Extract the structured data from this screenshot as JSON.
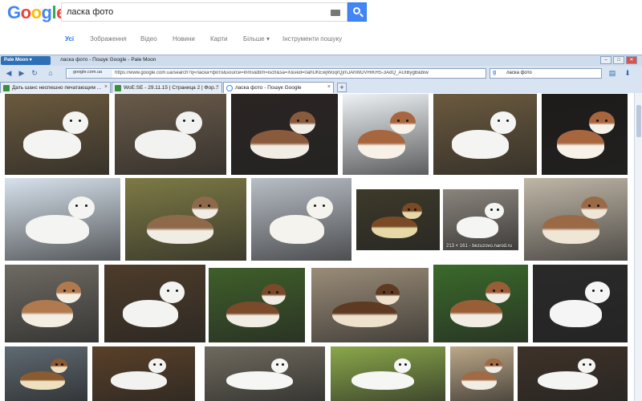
{
  "search": {
    "logo_letters": [
      {
        "ch": "G",
        "color": "#4285f4"
      },
      {
        "ch": "o",
        "color": "#ea4335"
      },
      {
        "ch": "o",
        "color": "#fbbc05"
      },
      {
        "ch": "g",
        "color": "#4285f4"
      },
      {
        "ch": "l",
        "color": "#34a853"
      },
      {
        "ch": "e",
        "color": "#ea4335"
      }
    ],
    "query": "ласка фото"
  },
  "tabs": [
    {
      "label": "Усі",
      "active": true
    },
    {
      "label": "Зображення",
      "active": false
    },
    {
      "label": "Відео",
      "active": false
    },
    {
      "label": "Новини",
      "active": false
    },
    {
      "label": "Карти",
      "active": false
    },
    {
      "label": "Більше ▾",
      "active": false
    },
    {
      "label": "Інструменти пошуку",
      "active": false
    }
  ],
  "browser": {
    "menu_button": "Pale Moon ▾",
    "window_title": "ласка фото - Пошук Google - Pale Moon",
    "url_domain": "google.com.ua",
    "url": "https://www.google.com.ua/search?q=ласка+фото&source=lnms&tbm=isch&sa=X&ved=0ahUKEwjWoqrQjrnJAhWDVHIKHS-3AdQ_AUIBygB&biw",
    "search_value": "ласка фото",
    "tabs": [
      {
        "label": "Дать шанс неспешно печатающим ...",
        "active": false
      },
      {
        "label": "WoE:SE - 29.11.15 | Страница 2 | Фор...",
        "active": false
      },
      {
        "label": "ласка фото - Пошук Google",
        "active": true
      }
    ]
  },
  "image_caption": "213 × 161 - bezuzovo.narod.ru",
  "images": [
    {
      "bg": "#6b5a3e",
      "fur": "#f4f4f2",
      "belly": "#f4f4f2"
    },
    {
      "bg": "#6a5b4a",
      "fur": "#f2f2f0",
      "belly": "#f2f2f0"
    },
    {
      "bg": "#2a2523",
      "fur": "#8a5a3c",
      "belly": "#f1ece4"
    },
    {
      "bg": "#eef2f5",
      "fur": "#a8663f",
      "belly": "#f7f1e8"
    },
    {
      "bg": "#6b5a3e",
      "fur": "#f4f4f2",
      "belly": "#f4f4f2"
    },
    {
      "bg": "#1e1b1a",
      "fur": "#a8663f",
      "belly": "#f7f1e8"
    },
    {
      "bg": "#d7e2ec",
      "fur": "#f4f4f2",
      "belly": "#f4f4f2"
    },
    {
      "bg": "#7d7a45",
      "fur": "#8f6a4a",
      "belly": "#f1ece4"
    },
    {
      "bg": "#b8bec6",
      "fur": "#f5f3ee",
      "belly": "#f5f3ee"
    },
    {
      "bg": "#3d3a2a",
      "fur": "#7a4a26",
      "belly": "#e7d8a8"
    },
    {
      "bg": "#8a847c",
      "fur": "#f5f5f3",
      "belly": "#f5f5f3"
    },
    {
      "bg": "#bfb6a6",
      "fur": "#9a6a46",
      "belly": "#efe6d6"
    },
    {
      "bg": "#6e6a63",
      "fur": "#b07a4e",
      "belly": "#f4ede2"
    },
    {
      "bg": "#4d3c2a",
      "fur": "#f3f3f1",
      "belly": "#f3f3f1"
    },
    {
      "bg": "#3f5f2a",
      "fur": "#7a4a2a",
      "belly": "#f1ece4"
    },
    {
      "bg": "#9a8c78",
      "fur": "#5e3a22",
      "belly": "#efe2cc"
    },
    {
      "bg": "#3a6a2a",
      "fur": "#9a5e36",
      "belly": "#f1ece4"
    },
    {
      "bg": "#2a2a2a",
      "fur": "#f5f5f5",
      "belly": "#f5f5f5"
    },
    {
      "bg": "#5f6a72",
      "fur": "#8a5a30",
      "belly": "#efe0c0"
    },
    {
      "bg": "#5a4028",
      "fur": "#f2f2f0",
      "belly": "#f2f2f0"
    },
    {
      "bg": "#6f6a5e",
      "fur": "#f6f6f4",
      "belly": "#f6f6f4"
    },
    {
      "bg": "#8aa84a",
      "fur": "#f6f6f4",
      "belly": "#f6f6f4"
    },
    {
      "bg": "#bda888",
      "fur": "#a06a44",
      "belly": "#f1ece4"
    },
    {
      "bg": "#3e3228",
      "fur": "#f4f4f2",
      "belly": "#f4f4f2"
    }
  ]
}
